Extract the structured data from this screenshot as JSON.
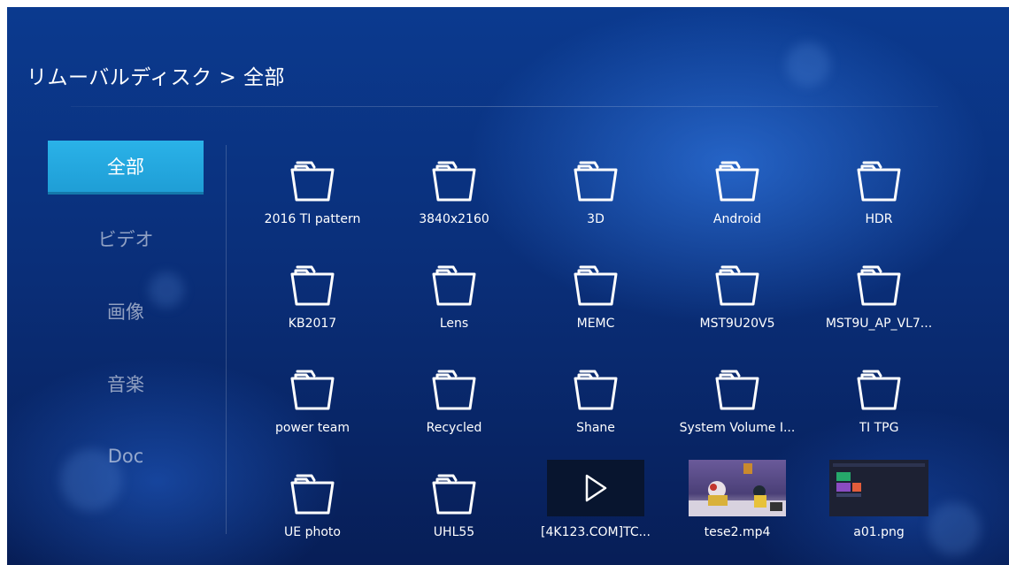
{
  "breadcrumb": "リムーバルディスク > 全部",
  "sidebar": {
    "items": [
      {
        "label": "全部",
        "active": true
      },
      {
        "label": "ビデオ",
        "active": false
      },
      {
        "label": "画像",
        "active": false
      },
      {
        "label": "音楽",
        "active": false
      },
      {
        "label": "Doc",
        "active": false
      }
    ]
  },
  "files": [
    {
      "label": "2016 TI pattern",
      "type": "folder"
    },
    {
      "label": "3840x2160",
      "type": "folder"
    },
    {
      "label": "3D",
      "type": "folder"
    },
    {
      "label": "Android",
      "type": "folder"
    },
    {
      "label": "HDR",
      "type": "folder"
    },
    {
      "label": "KB2017",
      "type": "folder"
    },
    {
      "label": "Lens",
      "type": "folder"
    },
    {
      "label": "MEMC",
      "type": "folder"
    },
    {
      "label": "MST9U20V5",
      "type": "folder"
    },
    {
      "label": "MST9U_AP_VL7...",
      "type": "folder"
    },
    {
      "label": "power team",
      "type": "folder"
    },
    {
      "label": "Recycled",
      "type": "folder"
    },
    {
      "label": "Shane",
      "type": "folder"
    },
    {
      "label": "System Volume I...",
      "type": "folder"
    },
    {
      "label": "TI TPG",
      "type": "folder"
    },
    {
      "label": "UE photo",
      "type": "folder"
    },
    {
      "label": "UHL55",
      "type": "folder"
    },
    {
      "label": "[4K123.COM]TC...",
      "type": "video"
    },
    {
      "label": "tese2.mp4",
      "type": "video-thumb"
    },
    {
      "label": "a01.png",
      "type": "image-thumb"
    }
  ],
  "colors": {
    "accent": "#1f9ed6",
    "background": "#0a2f7a",
    "text": "#ffffff"
  },
  "icons": {
    "folder": "folder-icon",
    "video": "play-icon"
  }
}
